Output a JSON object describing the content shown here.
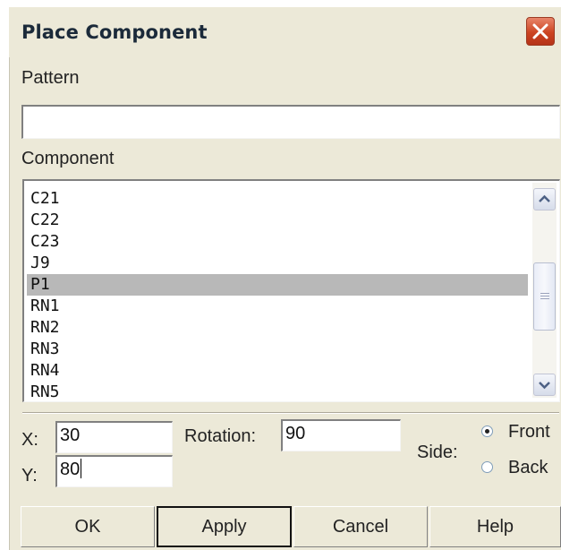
{
  "window": {
    "title": "Place Component"
  },
  "pattern": {
    "label": "Pattern",
    "value": ""
  },
  "component": {
    "label": "Component",
    "items": [
      "C21",
      "C22",
      "C23",
      "J9",
      "P1",
      "RN1",
      "RN2",
      "RN3",
      "RN4",
      "RN5"
    ],
    "selected": "P1"
  },
  "position": {
    "x_label": "X:",
    "x_value": "30",
    "y_label": "Y:",
    "y_value": "80"
  },
  "rotation": {
    "label": "Rotation:",
    "value": "90"
  },
  "side": {
    "label": "Side:",
    "options": [
      "Front",
      "Back"
    ],
    "selected": "Front"
  },
  "buttons": {
    "ok": "OK",
    "apply": "Apply",
    "cancel": "Cancel",
    "help": "Help"
  },
  "colors": {
    "dialog_bg": "#ece9d8",
    "close_button": "#cc4422",
    "selection": "#b8b8b8"
  },
  "icons": {
    "close": "close-icon",
    "scroll_up": "scroll-up-arrow-icon",
    "scroll_down": "scroll-down-arrow-icon"
  }
}
